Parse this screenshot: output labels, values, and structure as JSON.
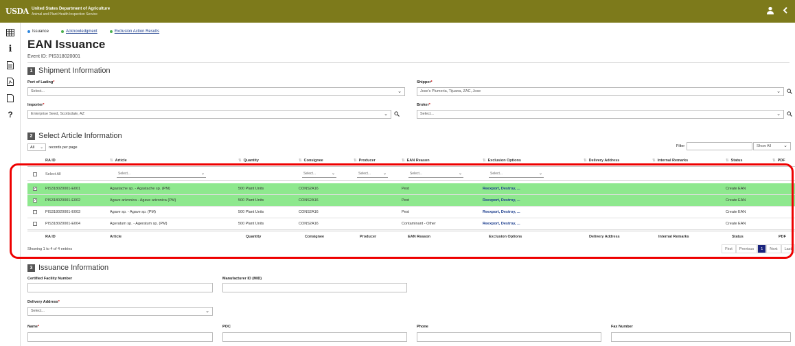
{
  "header": {
    "logo": "USDA",
    "agency_line1": "United States Department of Agriculture",
    "agency_line2": "Animal and Plant Health Inspection Service"
  },
  "sidebar": {
    "icons": [
      "grid-icon",
      "info-icon",
      "document-icon",
      "pdf-icon",
      "file-icon",
      "help-icon"
    ],
    "info_glyph": "i",
    "help_glyph": "?"
  },
  "breadcrumbs": [
    {
      "label": "Issuance"
    },
    {
      "label": "Acknowledgment"
    },
    {
      "label": "Exclusion Action Results"
    }
  ],
  "page": {
    "title": "EAN Issuance",
    "event_id": "Event ID: PIS318020001"
  },
  "sections": {
    "s1": {
      "num": "1",
      "title": "Shipment Information"
    },
    "s2": {
      "num": "2",
      "title": "Select Article Information"
    },
    "s3": {
      "num": "3",
      "title": "Issuance Information"
    }
  },
  "shipment": {
    "port_label": "Port of Lading",
    "port_value": "Select...",
    "shipper_label": "Shipper",
    "shipper_value": "Jose's Plumeria, Tijuana, ZAC, Jose",
    "importer_label": "Importer",
    "importer_value": "Enterprise Seed, Scottsdale, AZ",
    "broker_label": "Broker",
    "broker_value": "Select...",
    "required_mark": "*"
  },
  "table": {
    "rpp_value": "All",
    "rpp_label": "records per page",
    "filter_label": "Filter",
    "show_all": "Show All",
    "headers": [
      "RA ID",
      "Article",
      "Quantity",
      "Consignee",
      "Producer",
      "EAN Reason",
      "Exclusion Options",
      "Delivery Address",
      "Internal Remarks",
      "Status",
      "PDF"
    ],
    "filter_row": {
      "select_all": "Select All",
      "placeholder": "Select..."
    },
    "rows": [
      {
        "checked": true,
        "id": "PIS318020001-E001",
        "article": "Agastache sp. - Agastache sp. (PM)",
        "quantity": "500 Plant Units",
        "consignee": "CONS2A16",
        "reason": "Pest",
        "exclusion": "Reexport, Destroy, ...",
        "status": "Create EAN"
      },
      {
        "checked": true,
        "id": "PIS318020001-E002",
        "article": "Agave arizonica - Agave arizonica (PM)",
        "quantity": "500 Plant Units",
        "consignee": "CONS2A16",
        "reason": "Pest",
        "exclusion": "Reexport, Destroy, ...",
        "status": "Create EAN"
      },
      {
        "checked": false,
        "id": "PIS318020001-E003",
        "article": "Agave sp. - Agave sp. (PM)",
        "quantity": "500 Plant Units",
        "consignee": "CONS2A16",
        "reason": "Pest",
        "exclusion": "Reexport, Destroy, ...",
        "status": "Create EAN"
      },
      {
        "checked": false,
        "id": "PIS318020001-E004",
        "article": "Ageratum sp. - Ageratum sp. (PM)",
        "quantity": "500 Plant Units",
        "consignee": "CONS2A16",
        "reason": "Contaminant - Other",
        "exclusion": "Reexport, Destroy, ...",
        "status": "Create EAN"
      }
    ],
    "showing": "Showing 1 to 4 of 4 entries",
    "pager": [
      "First",
      "Previous",
      "1",
      "Next",
      "Last"
    ]
  },
  "issuance": {
    "cfn_label": "Certified Facility Number",
    "mid_label": "Manufacturer ID (MID)",
    "delivery_label": "Delivery Address",
    "delivery_value": "Select...",
    "name_label": "Name",
    "poc_label": "POC",
    "phone_label": "Phone",
    "fax_label": "Fax Number"
  },
  "colors": {
    "topbar": "#7d7a1b",
    "selected_row": "#8ee88e",
    "highlight": "#e00000",
    "pager_current": "#1a237e"
  }
}
